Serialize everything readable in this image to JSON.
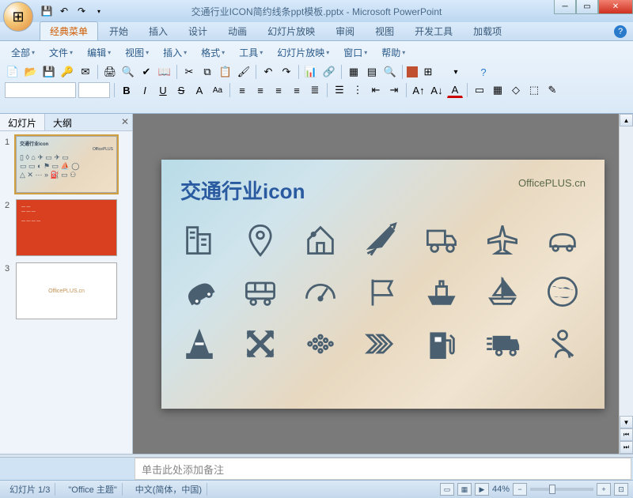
{
  "title": "交通行业ICON简约线条ppt模板.pptx - Microsoft PowerPoint",
  "ribbon_tabs": [
    "经典菜单",
    "开始",
    "插入",
    "设计",
    "动画",
    "幻灯片放映",
    "审阅",
    "视图",
    "开发工具",
    "加载项"
  ],
  "active_ribbon_tab_index": 0,
  "menu_row": [
    "全部",
    "文件",
    "编辑",
    "视图",
    "插入",
    "格式",
    "工具",
    "幻灯片放映",
    "窗口",
    "帮助"
  ],
  "side_tabs": [
    "幻灯片",
    "大纲"
  ],
  "active_side_tab_index": 0,
  "thumbnails": [
    {
      "num": "1",
      "title": "交通行业icon",
      "brand": "OfficePLUS"
    },
    {
      "num": "2"
    },
    {
      "num": "3",
      "brand": "OfficePLUS.cn"
    }
  ],
  "slide": {
    "title": "交通行业icon",
    "brand": "OfficePLUS.cn",
    "icons": [
      "building",
      "pin",
      "house",
      "plane-crash",
      "truck",
      "airplane",
      "car",
      "car-flip",
      "bus",
      "gauge",
      "flag",
      "ship",
      "sailboat",
      "globe",
      "cone",
      "cross-arrows",
      "dots-arrow",
      "chevrons",
      "gas-pump",
      "delivery-truck",
      "seatbelt"
    ]
  },
  "notes_placeholder": "单击此处添加备注",
  "status": {
    "slide": "幻灯片 1/3",
    "theme": "\"Office 主题\"",
    "lang": "中文(简体，中国)",
    "zoom": "44%"
  }
}
